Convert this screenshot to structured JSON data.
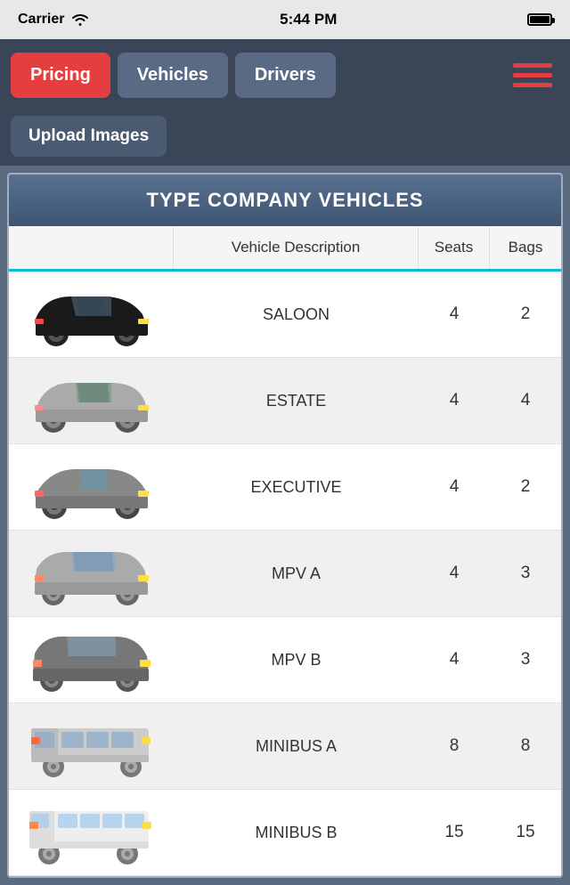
{
  "statusBar": {
    "carrier": "Carrier",
    "time": "5:44 PM",
    "battery": "full"
  },
  "header": {
    "tabs": [
      {
        "id": "pricing",
        "label": "Pricing",
        "active": true
      },
      {
        "id": "vehicles",
        "label": "Vehicles",
        "active": false
      },
      {
        "id": "drivers",
        "label": "Drivers",
        "active": false
      }
    ],
    "menuIcon": "☰"
  },
  "subNav": {
    "uploadLabel": "Upload Images"
  },
  "table": {
    "title": "TYPE COMPANY VEHICLES",
    "columns": [
      "",
      "Vehicle Description",
      "Seats",
      "Bags"
    ],
    "vehicles": [
      {
        "id": "saloon",
        "name": "SALOON",
        "seats": "4",
        "bags": "2",
        "shaded": false
      },
      {
        "id": "estate",
        "name": "ESTATE",
        "seats": "4",
        "bags": "4",
        "shaded": true
      },
      {
        "id": "executive",
        "name": "EXECUTIVE",
        "seats": "4",
        "bags": "2",
        "shaded": false
      },
      {
        "id": "mpv-a",
        "name": "MPV A",
        "seats": "4",
        "bags": "3",
        "shaded": true
      },
      {
        "id": "mpv-b",
        "name": "MPV B",
        "seats": "4",
        "bags": "3",
        "shaded": false
      },
      {
        "id": "minibus-a",
        "name": "MINIBUS A",
        "seats": "8",
        "bags": "8",
        "shaded": true
      },
      {
        "id": "minibus-b",
        "name": "MINIBUS B",
        "seats": "15",
        "bags": "15",
        "shaded": false
      }
    ]
  },
  "colors": {
    "activeTab": "#e53e3e",
    "inactiveTab": "#5a6a85",
    "navBg": "#3a4558",
    "tableTitleBg": "#4a6080",
    "accentCyan": "#00bcd4"
  }
}
